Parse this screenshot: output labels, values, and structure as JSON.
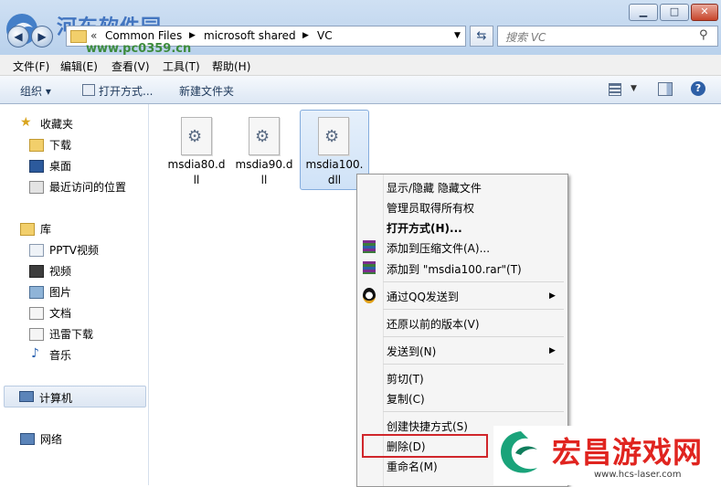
{
  "watermark": {
    "site_name": "河东软件园",
    "site_url": "www.pc0359.cn"
  },
  "window": {
    "minimize": "▁",
    "maximize": "□",
    "close": "✕"
  },
  "address": {
    "path": [
      "Common Files",
      "microsoft shared",
      "VC"
    ],
    "refresh_icon": "refresh-icon"
  },
  "search": {
    "placeholder": "搜索 VC"
  },
  "menubar": [
    "文件(F)",
    "编辑(E)",
    "查看(V)",
    "工具(T)",
    "帮助(H)"
  ],
  "toolbar": {
    "organize": "组织 ▾",
    "open_with": "打开方式...",
    "new_folder": "新建文件夹"
  },
  "nav": {
    "favorites": {
      "title": "收藏夹",
      "items": [
        "下载",
        "桌面",
        "最近访问的位置"
      ]
    },
    "libraries": {
      "title": "库",
      "items": [
        "PPTV视频",
        "视频",
        "图片",
        "文档",
        "迅雷下载",
        "音乐"
      ]
    },
    "computer": "计算机",
    "network": "网络"
  },
  "files": [
    {
      "name_line1": "msdia80.d",
      "name_line2": "ll"
    },
    {
      "name_line1": "msdia90.d",
      "name_line2": "ll"
    },
    {
      "name_line1": "msdia100.",
      "name_line2": "dll"
    }
  ],
  "context_menu": {
    "items": [
      "显示/隐藏 隐藏文件",
      "管理员取得所有权",
      "打开方式(H)...",
      "添加到压缩文件(A)...",
      "添加到 \"msdia100.rar\"(T)",
      "通过QQ发送到",
      "还原以前的版本(V)",
      "发送到(N)",
      "剪切(T)",
      "复制(C)",
      "创建快捷方式(S)",
      "删除(D)",
      "重命名(M)"
    ]
  },
  "brand": {
    "name": "宏昌游戏网",
    "url": "www.hcs-laser.com"
  },
  "colors": {
    "highlight_box": "#d0262b",
    "brand_red": "#e0241f",
    "accent_blue": "#1f4e9a"
  }
}
